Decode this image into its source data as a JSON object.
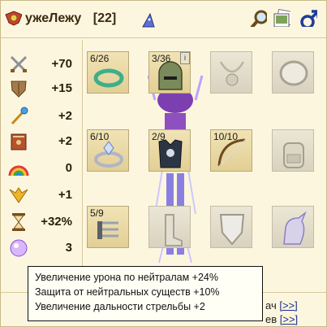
{
  "header": {
    "nickname": "ужеЛежу",
    "level": "[22]",
    "icons": [
      "clan-emblem-icon",
      "wizard-hat-icon",
      "magnifier-icon",
      "photos-icon",
      "male-gender-icon"
    ]
  },
  "stats": [
    {
      "icon": "crossed-swords-icon",
      "value": "+70"
    },
    {
      "icon": "shield-icon",
      "value": "+15"
    },
    {
      "icon": "magic-wand-icon",
      "value": "+2"
    },
    {
      "icon": "spellbook-icon",
      "value": "+2"
    },
    {
      "icon": "rainbow-icon",
      "value": "0"
    },
    {
      "icon": "golden-wings-icon",
      "value": "+1"
    },
    {
      "icon": "hourglass-icon",
      "value": "+32%"
    },
    {
      "icon": "magic-orb-icon",
      "value": "3"
    }
  ],
  "slots": {
    "amulet_ring": {
      "count": "6/26",
      "item": "ring-icon"
    },
    "helmet": {
      "count": "3/36",
      "item": "helmet-icon"
    },
    "necklace": {
      "item": "necklace-icon"
    },
    "mirror": {
      "item": "mirror-icon"
    },
    "ring": {
      "count": "6/10",
      "item": "diamond-ring-icon"
    },
    "armor": {
      "count": "2/9",
      "item": "armor-vest-icon"
    },
    "bow": {
      "count": "10/10",
      "item": "bow-icon"
    },
    "backpack": {
      "item": "backpack-icon"
    },
    "weapon": {
      "count": "5/9",
      "item": "claw-weapon-icon"
    },
    "boots": {
      "item": "boots-icon"
    },
    "shield": {
      "item": "shield-slot-icon"
    },
    "mount": {
      "item": "unicorn-icon"
    }
  },
  "tooltip": {
    "line1": "Увеличение урона по нейтралам +24%",
    "line2": "Защита от нейтральных существ +10%",
    "line3": "Увеличение дальности стрельбы +2"
  },
  "right_links": {
    "row1_text": "ач",
    "row1_link": "[>>]",
    "row2_text": "ев",
    "row2_link": "[>>]"
  }
}
